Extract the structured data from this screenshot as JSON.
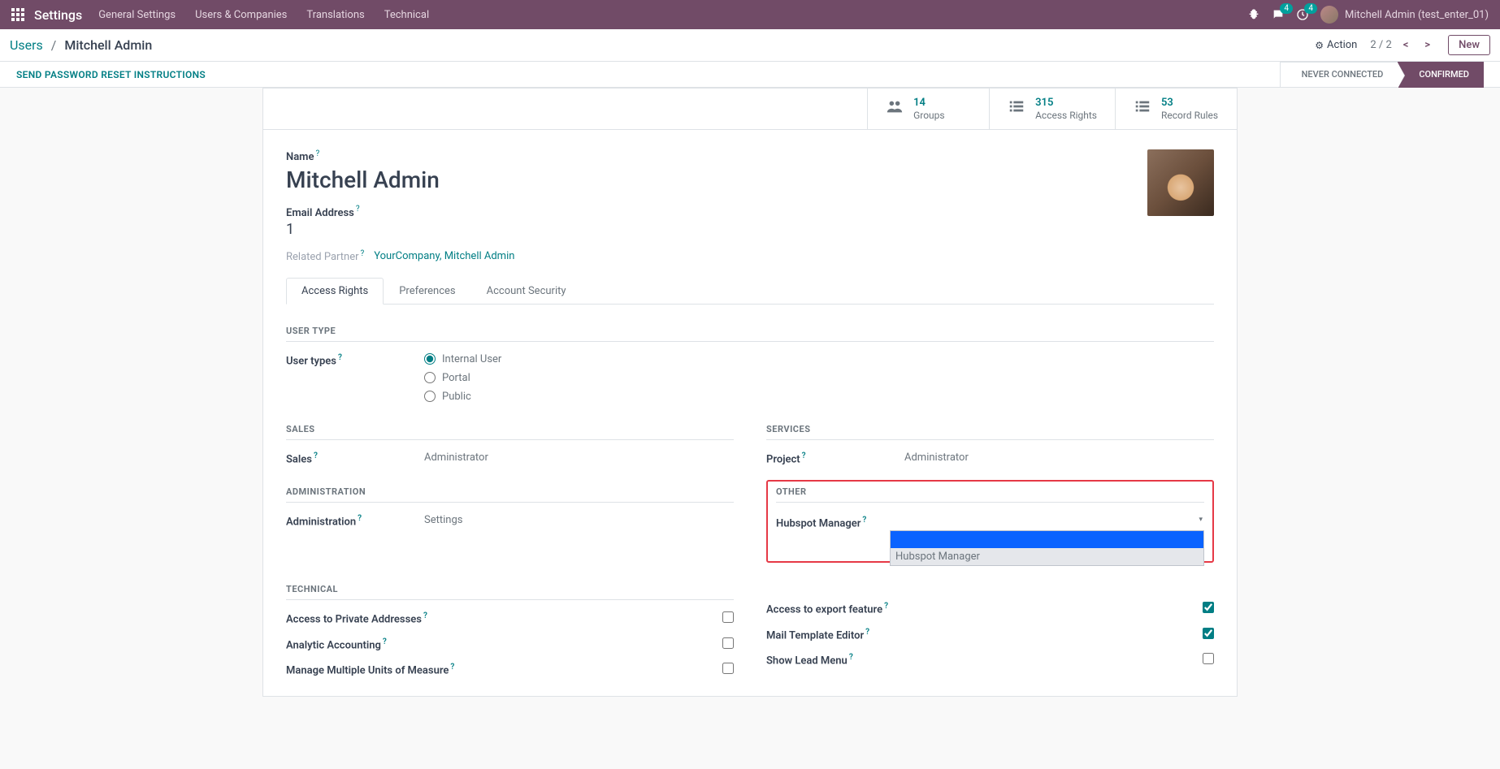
{
  "nav": {
    "brand": "Settings",
    "items": [
      "General Settings",
      "Users & Companies",
      "Translations",
      "Technical"
    ],
    "msg_badge": "4",
    "clock_badge": "4",
    "user_label": "Mitchell Admin (test_enter_01)"
  },
  "breadcrumb": {
    "root": "Users",
    "current": "Mitchell Admin"
  },
  "controlbar": {
    "action": "Action",
    "pager": "2 / 2",
    "new_btn": "New"
  },
  "statusbar": {
    "link": "SEND PASSWORD RESET INSTRUCTIONS",
    "steps": [
      "NEVER CONNECTED",
      "CONFIRMED"
    ]
  },
  "stats": [
    {
      "num": "14",
      "lbl": "Groups"
    },
    {
      "num": "315",
      "lbl": "Access Rights"
    },
    {
      "num": "53",
      "lbl": "Record Rules"
    }
  ],
  "form": {
    "name_lbl": "Name",
    "name_val": "Mitchell Admin",
    "email_lbl": "Email Address",
    "email_val": "1",
    "rp_lbl": "Related Partner",
    "rp_val": "YourCompany, Mitchell Admin"
  },
  "tabs": [
    "Access Rights",
    "Preferences",
    "Account Security"
  ],
  "sections": {
    "usertype_hdr": "USER TYPE",
    "usertype_lbl": "User types",
    "usertype_opts": [
      "Internal User",
      "Portal",
      "Public"
    ],
    "sales_hdr": "SALES",
    "sales_lbl": "Sales",
    "sales_val": "Administrator",
    "services_hdr": "SERVICES",
    "project_lbl": "Project",
    "project_val": "Administrator",
    "admin_hdr": "ADMINISTRATION",
    "admin_lbl": "Administration",
    "admin_val": "Settings",
    "other_hdr": "OTHER",
    "hubspot_lbl": "Hubspot Manager",
    "hubspot_opts": [
      "",
      "Hubspot Manager"
    ],
    "tech_hdr": "TECHNICAL",
    "tech_left": [
      "Access to Private Addresses",
      "Analytic Accounting",
      "Manage Multiple Units of Measure"
    ],
    "tech_right": [
      {
        "lbl": "Access to export feature",
        "chk": true
      },
      {
        "lbl": "Mail Template Editor",
        "chk": true
      },
      {
        "lbl": "Show Lead Menu",
        "chk": false
      }
    ]
  }
}
